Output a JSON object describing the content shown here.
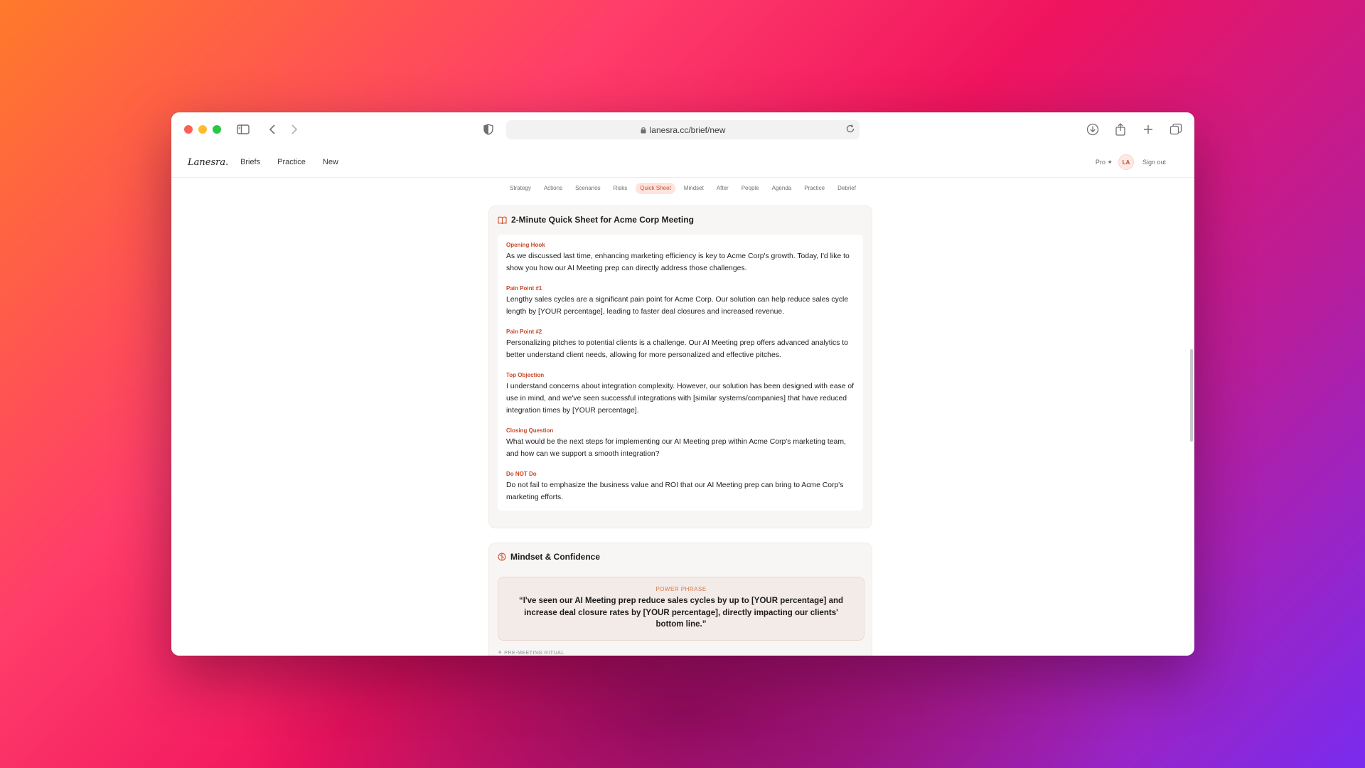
{
  "browser": {
    "url": "lanesra.cc/brief/new"
  },
  "app": {
    "logo": "Lanesra.",
    "nav": [
      "Briefs",
      "Practice",
      "New"
    ],
    "plan": "Pro ✦",
    "avatar_initials": "LA",
    "sign_out": "Sign out"
  },
  "tabs": [
    {
      "label": "Strategy",
      "active": false
    },
    {
      "label": "Actions",
      "active": false
    },
    {
      "label": "Scenarios",
      "active": false
    },
    {
      "label": "Risks",
      "active": false
    },
    {
      "label": "Quick Sheet",
      "active": true
    },
    {
      "label": "Mindset",
      "active": false
    },
    {
      "label": "After",
      "active": false
    },
    {
      "label": "People",
      "active": false
    },
    {
      "label": "Agenda",
      "active": false
    },
    {
      "label": "Practice",
      "active": false
    },
    {
      "label": "Debrief",
      "active": false
    }
  ],
  "quick_sheet": {
    "title": "2-Minute Quick Sheet for Acme Corp Meeting",
    "sections": [
      {
        "label": "Opening Hook",
        "text": "As we discussed last time, enhancing marketing efficiency is key to Acme Corp's growth. Today, I'd like to show you how our AI Meeting prep can directly address those challenges."
      },
      {
        "label": "Pain Point #1",
        "text": "Lengthy sales cycles are a significant pain point for Acme Corp. Our solution can help reduce sales cycle length by [YOUR percentage], leading to faster deal closures and increased revenue."
      },
      {
        "label": "Pain Point #2",
        "text": "Personalizing pitches to potential clients is a challenge. Our AI Meeting prep offers advanced analytics to better understand client needs, allowing for more personalized and effective pitches."
      },
      {
        "label": "Top Objection",
        "text": "I understand concerns about integration complexity. However, our solution has been designed with ease of use in mind, and we've seen successful integrations with [similar systems/companies] that have reduced integration times by [YOUR percentage]."
      },
      {
        "label": "Closing Question",
        "text": "What would be the next steps for implementing our AI Meeting prep within Acme Corp's marketing team, and how can we support a smooth integration?"
      },
      {
        "label": "Do NOT Do",
        "text": "Do not fail to emphasize the business value and ROI that our AI Meeting prep can bring to Acme Corp's marketing efforts."
      }
    ]
  },
  "mindset": {
    "title": "Mindset & Confidence",
    "power_label": "POWER PHRASE",
    "power_text": "“I've seen our AI Meeting prep reduce sales cycles by up to [YOUR percentage] and increase deal closure rates by [YOUR percentage], directly impacting our clients' bottom line.”",
    "ritual_label": "PRE-MEETING RITUAL"
  },
  "colors": {
    "accent": "#d0502f",
    "tab_active_bg": "#fde4de"
  }
}
